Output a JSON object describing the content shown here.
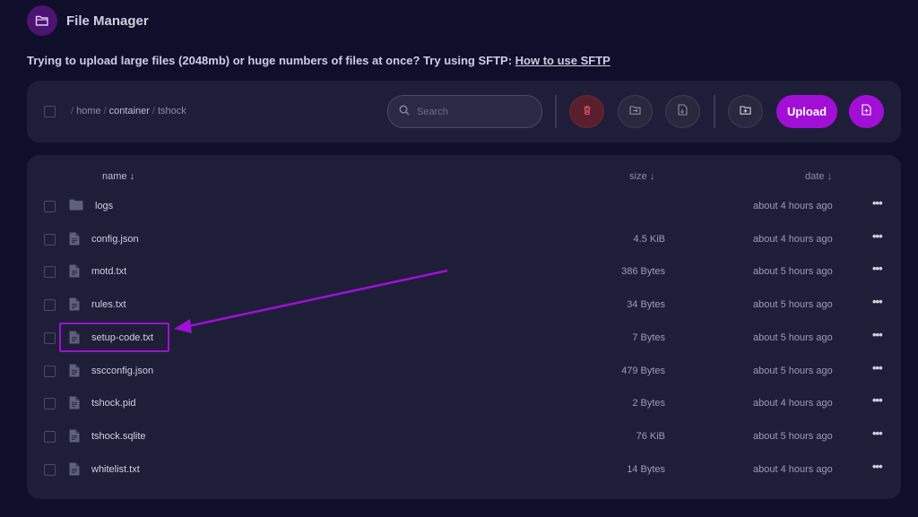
{
  "header": {
    "title": "File Manager",
    "icon": "folder-open-icon"
  },
  "notice": {
    "text": "Trying to upload large files (2048mb) or huge numbers of files at once? Try using SFTP: ",
    "link": "How to use SFTP"
  },
  "breadcrumb": {
    "root": "/",
    "home": "home",
    "container": "container",
    "current": "tshock"
  },
  "search": {
    "placeholder": "Search"
  },
  "toolbar": {
    "upload_label": "Upload"
  },
  "columns": {
    "name": "name ↓",
    "size": "size ↓",
    "date": "date ↓"
  },
  "files": [
    {
      "name": "logs",
      "type": "folder",
      "size": "",
      "date": "about 4 hours ago"
    },
    {
      "name": "config.json",
      "type": "file",
      "size": "4.5 KiB",
      "date": "about 4 hours ago"
    },
    {
      "name": "motd.txt",
      "type": "file",
      "size": "386 Bytes",
      "date": "about 5 hours ago"
    },
    {
      "name": "rules.txt",
      "type": "file",
      "size": "34 Bytes",
      "date": "about 5 hours ago"
    },
    {
      "name": "setup-code.txt",
      "type": "file",
      "size": "7 Bytes",
      "date": "about 5 hours ago"
    },
    {
      "name": "sscconfig.json",
      "type": "file",
      "size": "479 Bytes",
      "date": "about 5 hours ago"
    },
    {
      "name": "tshock.pid",
      "type": "file",
      "size": "2 Bytes",
      "date": "about 4 hours ago"
    },
    {
      "name": "tshock.sqlite",
      "type": "file",
      "size": "76 KiB",
      "date": "about 5 hours ago"
    },
    {
      "name": "whitelist.txt",
      "type": "file",
      "size": "14 Bytes",
      "date": "about 4 hours ago"
    }
  ],
  "more_label": "•••",
  "colors": {
    "accent": "#a10fd6",
    "background": "#0f0f2b",
    "panel": "#1e1e39",
    "delete": "#5a1f2d"
  }
}
